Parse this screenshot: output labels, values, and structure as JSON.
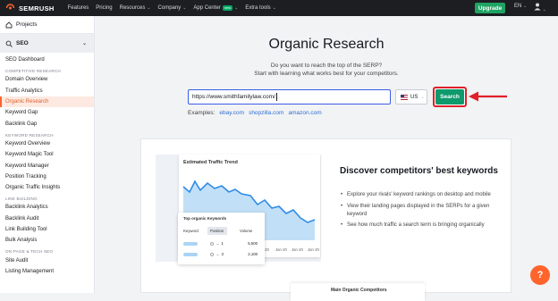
{
  "topbar": {
    "brand": "SEMRUSH",
    "nav": [
      {
        "label": "Features",
        "has_menu": false
      },
      {
        "label": "Pricing",
        "has_menu": false
      },
      {
        "label": "Resources",
        "has_menu": true
      },
      {
        "label": "Company",
        "has_menu": true
      },
      {
        "label": "App Center",
        "has_menu": true,
        "badge": "new"
      },
      {
        "label": "Extra tools",
        "has_menu": true
      }
    ],
    "upgrade_label": "Upgrade",
    "language": "EN",
    "user_icon": "user-icon"
  },
  "sidebar": {
    "projects_label": "Projects",
    "seo_label": "SEO",
    "seo_dashboard": "SEO Dashboard",
    "sections": [
      {
        "title": "COMPETITIVE RESEARCH",
        "items": [
          "Domain Overview",
          "Traffic Analytics",
          "Organic Research",
          "Keyword Gap",
          "Backlink Gap"
        ]
      },
      {
        "title": "KEYWORD RESEARCH",
        "items": [
          "Keyword Overview",
          "Keyword Magic Tool",
          "Keyword Manager",
          "Position Tracking",
          "Organic Traffic Insights"
        ]
      },
      {
        "title": "LINK BUILDING",
        "items": [
          "Backlink Analytics",
          "Backlink Audit",
          "Link Building Tool",
          "Bulk Analysis"
        ]
      },
      {
        "title": "ON PAGE & TECH SEO",
        "items": [
          "Site Audit",
          "Listing Management"
        ]
      }
    ],
    "active_item": "Organic Research"
  },
  "main": {
    "title": "Organic Research",
    "subtitle_1": "Do you want to reach the top of the SERP?",
    "subtitle_2": "Start with learning what works best for your competitors.",
    "url_value": "https://www.smithfamilylaw.com/",
    "country": "US",
    "search_label": "Search",
    "examples_label": "Examples:",
    "examples": [
      "ebay.com",
      "shopzilla.com",
      "amazon.com"
    ]
  },
  "promo": {
    "chart_title": "Estimated Traffic Trend",
    "x_labels": [
      "Jan 20",
      "Jan 20",
      "Jan 20",
      "Jan 20"
    ],
    "keywords_card": {
      "title": "Top organic Keywords",
      "headers": [
        "Keyword",
        "Position",
        "Volume"
      ],
      "rows": [
        {
          "position": "1",
          "volume": "5,500"
        },
        {
          "position": "3",
          "volume": "2,100"
        }
      ]
    },
    "heading": "Discover competitors' best keywords",
    "bullets": [
      "Explore your rivals' keyword rankings on desktop and mobile",
      "View their landing pages displayed in the SERPs for a given keyword",
      "See how much traffic a search term is bringing organically"
    ]
  },
  "bottom_card_title": "Main Organic Competitors",
  "help_label": "?",
  "colors": {
    "accent_orange": "#ff642d",
    "search_green": "#0d9a6c",
    "upgrade_green": "#1ea362",
    "highlight_red": "#e0202a",
    "link_blue": "#2f6ed2"
  }
}
